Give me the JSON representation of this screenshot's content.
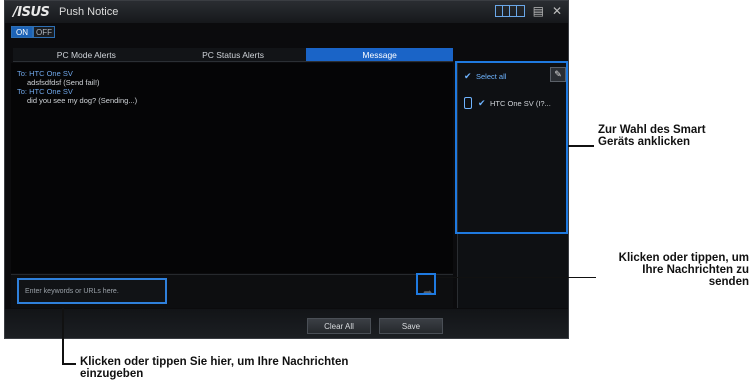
{
  "app": {
    "logo": "/ISUS",
    "title": "Push Notice",
    "toggle_on": "ON",
    "toggle_off": "OFF"
  },
  "tabs": [
    {
      "label": "PC Mode Alerts"
    },
    {
      "label": "PC Status Alerts"
    },
    {
      "label": "Message"
    }
  ],
  "messages": [
    {
      "to": "To: HTC One SV",
      "body": "adsfsdfdsf    (Send fail!)"
    },
    {
      "to": "To: HTC One SV",
      "body": "did you see my dog?    (Sending...)"
    }
  ],
  "input": {
    "placeholder": "Enter keywords or URLs here."
  },
  "buttons": {
    "clear_all": "Clear All",
    "save": "Save"
  },
  "right_panel": {
    "select_all": "Select all",
    "device_label": "HTC One SV (I?..."
  },
  "callouts": {
    "device_select": "Zur Wahl des Smart Geräts anklicken",
    "send": "Klicken oder tippen, um Ihre Nachrichten zu senden",
    "input": "Klicken oder tippen Sie hier, um Ihre Nachrichten einzugeben"
  },
  "colors": {
    "accent": "#1a64c7",
    "highlight": "#1f7ae0"
  }
}
